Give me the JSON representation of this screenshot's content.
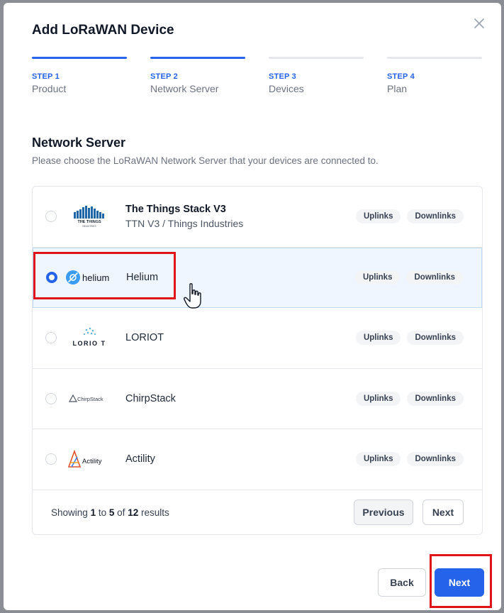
{
  "dialog": {
    "title": "Add LoRaWAN Device",
    "close_icon": "close-icon"
  },
  "steps": [
    {
      "num": "STEP 1",
      "name": "Product",
      "complete": true
    },
    {
      "num": "STEP 2",
      "name": "Network Server",
      "complete": true
    },
    {
      "num": "STEP 3",
      "name": "Devices",
      "complete": false
    },
    {
      "num": "STEP 4",
      "name": "Plan",
      "complete": false
    }
  ],
  "section": {
    "title": "Network Server",
    "description": "Please choose the LoRaWAN Network Server that your devices are connected to."
  },
  "servers": [
    {
      "name": "The Things Stack V3",
      "subtitle": "TTN V3 / Things Industries",
      "logo_text": "THE THINGS",
      "logo_subtext": "INDUSTRIES",
      "selected": false,
      "tags": [
        "Uplinks",
        "Downlinks"
      ]
    },
    {
      "name": "Helium",
      "logo_text": "helium",
      "selected": true,
      "tags": [
        "Uplinks",
        "Downlinks"
      ]
    },
    {
      "name": "LORIOT",
      "logo_text": "LORIO T",
      "selected": false,
      "tags": [
        "Uplinks",
        "Downlinks"
      ]
    },
    {
      "name": "ChirpStack",
      "logo_text": "ChirpStack",
      "selected": false,
      "tags": [
        "Uplinks",
        "Downlinks"
      ]
    },
    {
      "name": "Actility",
      "logo_text": "Actility",
      "selected": false,
      "tags": [
        "Uplinks",
        "Downlinks"
      ]
    }
  ],
  "pagination": {
    "showing_prefix": "Showing",
    "from": "1",
    "to_word": "to",
    "to": "5",
    "of_word": "of",
    "total": "12",
    "results_word": "results",
    "previous_label": "Previous",
    "next_label": "Next"
  },
  "footer": {
    "back_label": "Back",
    "next_label": "Next"
  },
  "colors": {
    "accent": "#2563eb",
    "highlight": "#e0151b",
    "selected_row": "#eff6ff"
  }
}
